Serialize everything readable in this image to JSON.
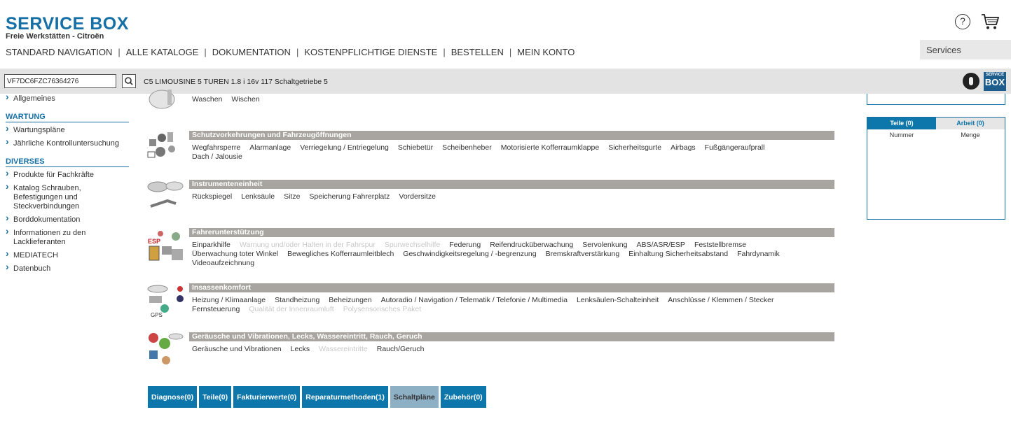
{
  "header": {
    "logo_title": "SERVICE BOX",
    "logo_subtitle": "Freie Werkstätten - Citroën",
    "nav": [
      "STANDARD NAVIGATION",
      "ALLE KATALOGE",
      "DOKUMENTATION",
      "KOSTENPFLICHTIGE DIENSTE",
      "BESTELLEN",
      "MEIN KONTO"
    ],
    "help_symbol": "?",
    "services_label": "Services",
    "brand_color": "#1670a5"
  },
  "searchbar": {
    "vin_value": "VF7DC6FZC76364276",
    "vehicle": "C5 LIMOUSINE 5 TUREN 1.8 i 16v 117 Schaltgetriebe 5",
    "sbx_small": "SERVICE",
    "sbx_big": "BOX"
  },
  "sidebar": {
    "items_a": [
      "Allgemeines"
    ],
    "heading_wartung": "WARTUNG",
    "items_wartung": [
      "Wartungspläne",
      "Jährliche Kontrolluntersuchung"
    ],
    "heading_diverses": "DIVERSES",
    "items_diverses": [
      "Produkte für Fachkräfte",
      "Katalog Schrauben, Befestigungen und Steckverbindungen",
      "Borddokumentation",
      "Informationen zu den Lacklieferanten",
      "MEDIATECH",
      "Datenbuch"
    ]
  },
  "categories": [
    {
      "title": "",
      "links": [
        {
          "t": "Waschen",
          "dim": false
        },
        {
          "t": "Wischen",
          "dim": false
        }
      ]
    },
    {
      "title": "Schutzvorkehrungen und Fahrzeugöffnungen",
      "links": [
        {
          "t": "Wegfahrsperre",
          "dim": false
        },
        {
          "t": "Alarmanlage",
          "dim": false
        },
        {
          "t": "Verriegelung / Entriegelung",
          "dim": false
        },
        {
          "t": "Schiebetür",
          "dim": false
        },
        {
          "t": "Scheibenheber",
          "dim": false
        },
        {
          "t": "Motorisierte Kofferraumklappe",
          "dim": false
        },
        {
          "t": "Sicherheitsgurte",
          "dim": false
        },
        {
          "t": "Airbags",
          "dim": false
        },
        {
          "t": "Fußgängeraufprall",
          "dim": false
        },
        {
          "t": "Dach / Jalousie",
          "dim": false
        }
      ]
    },
    {
      "title": "Instrumenteneinheit",
      "links": [
        {
          "t": "Rückspiegel",
          "dim": false
        },
        {
          "t": "Lenksäule",
          "dim": false
        },
        {
          "t": "Sitze",
          "dim": false
        },
        {
          "t": "Speicherung Fahrerplatz",
          "dim": false
        },
        {
          "t": "Vordersitze",
          "dim": false
        }
      ]
    },
    {
      "title": "Fahrerunterstützung",
      "links": [
        {
          "t": "Einparkhilfe",
          "dim": false
        },
        {
          "t": "Warnung und/oder Halten in der Fahrspur",
          "dim": true
        },
        {
          "t": "Spurwechselhilfe",
          "dim": true
        },
        {
          "t": "Federung",
          "dim": false
        },
        {
          "t": "Reifendrucküberwachung",
          "dim": false
        },
        {
          "t": "Servolenkung",
          "dim": false
        },
        {
          "t": "ABS/ASR/ESP",
          "dim": false
        },
        {
          "t": "Feststellbremse",
          "dim": false
        },
        {
          "t": "Überwachung toter Winkel",
          "dim": false
        },
        {
          "t": "Bewegliches Kofferraumleitblech",
          "dim": false
        },
        {
          "t": "Geschwindigkeitsregelung / -begrenzung",
          "dim": false
        },
        {
          "t": "Bremskraftverstärkung",
          "dim": false
        },
        {
          "t": "Einhaltung Sicherheitsabstand",
          "dim": false
        },
        {
          "t": "Fahrdynamik",
          "dim": false
        },
        {
          "t": "Videoaufzeichnung",
          "dim": false
        }
      ]
    },
    {
      "title": "Insassenkomfort",
      "links": [
        {
          "t": "Heizung / Klimaanlage",
          "dim": false
        },
        {
          "t": "Standheizung",
          "dim": false
        },
        {
          "t": "Beheizungen",
          "dim": false
        },
        {
          "t": "Autoradio / Navigation / Telematik / Telefonie / Multimedia",
          "dim": false
        },
        {
          "t": "Lenksäulen-Schalteinheit",
          "dim": false
        },
        {
          "t": "Anschlüsse / Klemmen / Stecker",
          "dim": false
        },
        {
          "t": "Fernsteuerung",
          "dim": false
        },
        {
          "t": "Qualität der Innenraumluft",
          "dim": true
        },
        {
          "t": "Polysensorisches Paket",
          "dim": true
        }
      ]
    },
    {
      "title": "Geräusche und Vibrationen, Lecks, Wassereintritt, Rauch, Geruch",
      "links": [
        {
          "t": "Geräusche und Vibrationen",
          "dim": false
        },
        {
          "t": "Lecks",
          "dim": false
        },
        {
          "t": "Wassereintritte",
          "dim": true
        },
        {
          "t": "Rauch/Geruch",
          "dim": false
        }
      ]
    }
  ],
  "tabs": [
    {
      "label": "Diagnose(0)",
      "active": false
    },
    {
      "label": "Teile(0)",
      "active": false
    },
    {
      "label": "Fakturierwerte(0)",
      "active": false
    },
    {
      "label": "Reparaturmethoden(1)",
      "active": false
    },
    {
      "label": "Schaltpläne",
      "active": true
    },
    {
      "label": "Zubehör(0)",
      "active": false
    }
  ],
  "cart": {
    "tab_parts": "Teile (0)",
    "tab_labor": "Arbeit (0)",
    "col_number": "Nummer",
    "col_quantity": "Menge"
  }
}
